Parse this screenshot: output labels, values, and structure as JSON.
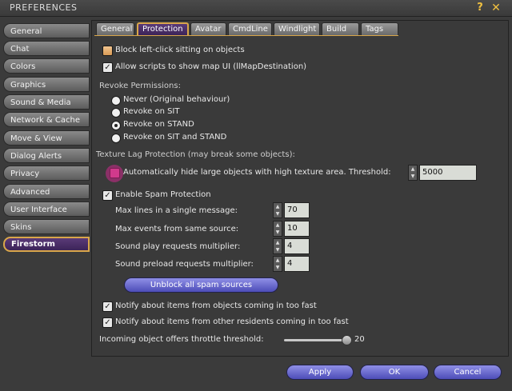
{
  "window": {
    "title": "PREFERENCES",
    "help_glyph": "?",
    "close_glyph": "✕"
  },
  "sidebar": {
    "items": [
      {
        "label": "General"
      },
      {
        "label": "Chat"
      },
      {
        "label": "Colors"
      },
      {
        "label": "Graphics"
      },
      {
        "label": "Sound & Media"
      },
      {
        "label": "Network & Cache"
      },
      {
        "label": "Move & View"
      },
      {
        "label": "Dialog Alerts"
      },
      {
        "label": "Privacy"
      },
      {
        "label": "Advanced"
      },
      {
        "label": "User Interface"
      },
      {
        "label": "Skins"
      },
      {
        "label": "Firestorm",
        "active": true
      }
    ]
  },
  "tabs": [
    {
      "label": "General"
    },
    {
      "label": "Protection",
      "active": true
    },
    {
      "label": "Avatar"
    },
    {
      "label": "CmdLine"
    },
    {
      "label": "Windlight"
    },
    {
      "label": "Build"
    },
    {
      "label": "Tags"
    }
  ],
  "protection": {
    "block_sit_label": "Block left-click sitting on objects",
    "block_sit_checked": false,
    "allow_map_label": "Allow scripts to show map UI (llMapDestination)",
    "allow_map_checked": true,
    "revoke_heading": "Revoke Permissions:",
    "revoke_options": [
      {
        "label": "Never (Original behaviour)",
        "selected": false
      },
      {
        "label": "Revoke on SIT",
        "selected": false
      },
      {
        "label": "Revoke on STAND",
        "selected": true
      },
      {
        "label": "Revoke on SIT and STAND",
        "selected": false
      }
    ],
    "texture_heading": "Texture Lag Protection (may break some objects):",
    "texture_hide_label": "Automatically hide large objects with high texture area. Threshold:",
    "texture_hide_checked": false,
    "texture_threshold": "5000",
    "spam_label": "Enable Spam Protection",
    "spam_checked": true,
    "spam_fields": [
      {
        "label": "Max lines in a single message:",
        "value": "70"
      },
      {
        "label": "Max events from same source:",
        "value": "10"
      },
      {
        "label": "Sound play requests multiplier:",
        "value": "4"
      },
      {
        "label": "Sound preload requests multiplier:",
        "value": "4"
      }
    ],
    "unblock_button": "Unblock all spam sources",
    "notify_objects_label": "Notify about items from objects coming in too fast",
    "notify_objects_checked": true,
    "notify_residents_label": "Notify about items from other residents coming in too fast",
    "notify_residents_checked": true,
    "throttle_label": "Incoming object offers throttle threshold:",
    "throttle_value": "20"
  },
  "footer": {
    "apply": "Apply",
    "ok": "OK",
    "cancel": "Cancel"
  },
  "colors": {
    "accent_gold": "#d9a64a",
    "active_purple": "#4a2e68",
    "button_blue": "#5f5fcc",
    "highlight_pink": "#d13a8c"
  }
}
